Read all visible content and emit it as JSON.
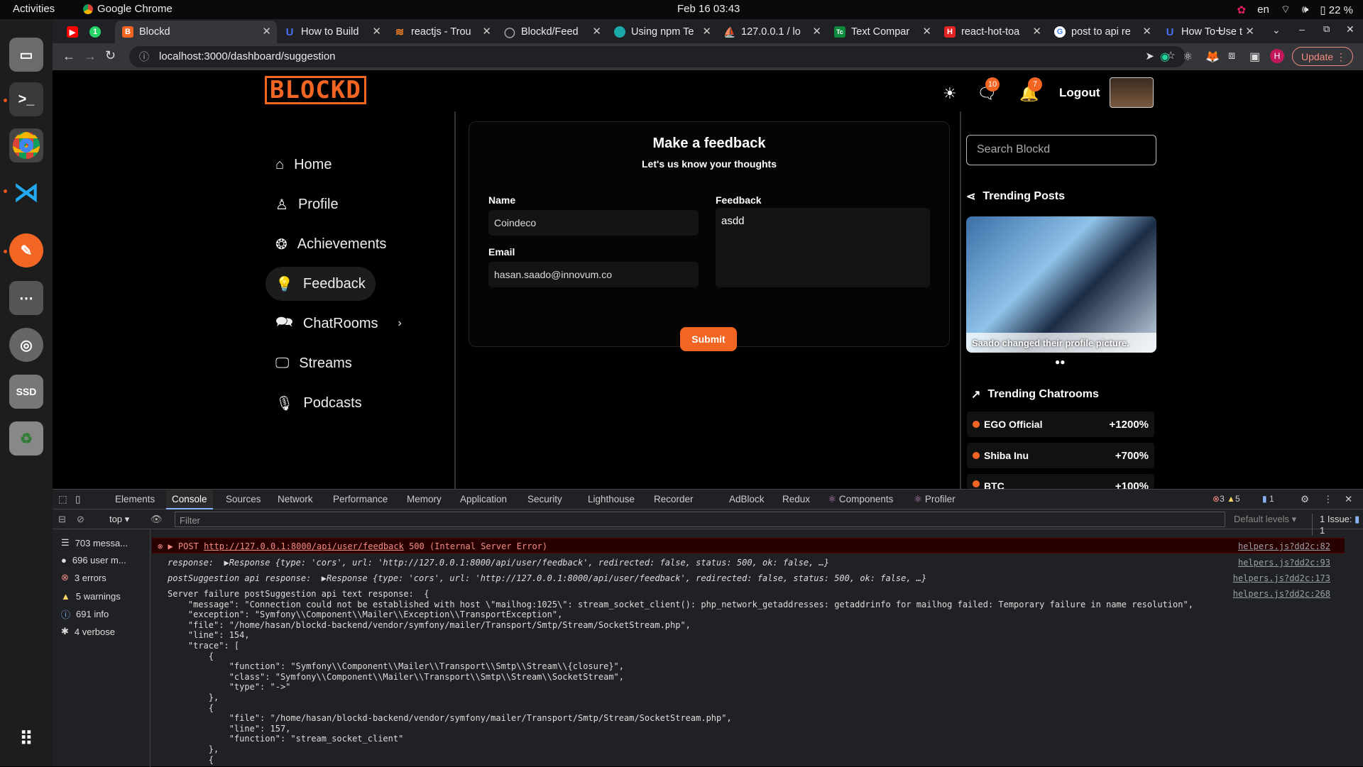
{
  "topbar": {
    "activities": "Activities",
    "app": "Google Chrome",
    "clock": "Feb 16  03:43",
    "lang": "en",
    "battery": "22 %"
  },
  "tabs": [
    {
      "label": "",
      "icon": "youtube-icon",
      "color": "#ff0000"
    },
    {
      "label": "",
      "icon": "whatsapp-icon",
      "color": "#25d366"
    },
    {
      "label": "Blockd",
      "icon": "blockd-icon",
      "color": "#f26522"
    },
    {
      "label": "How to Build",
      "icon": "u-icon",
      "color": "#4a6cf7"
    },
    {
      "label": "reactjs - Trou",
      "icon": "stackoverflow-icon",
      "color": "#f48024"
    },
    {
      "label": "Blockd/Feed",
      "icon": "github-icon",
      "color": "#888"
    },
    {
      "label": "Using npm Te",
      "icon": "globe-icon",
      "color": "#1ba9a9"
    },
    {
      "label": "127.0.0.1 / lo",
      "icon": "phpmyadmin-icon",
      "color": "#e8a33d"
    },
    {
      "label": "Text Compar",
      "icon": "tc-icon",
      "color": "#0a8a3a"
    },
    {
      "label": "react-hot-toa",
      "icon": "rh-icon",
      "color": "#e02424"
    },
    {
      "label": "post to api re",
      "icon": "google-icon",
      "color": "#4285f4"
    },
    {
      "label": "How To Use t",
      "icon": "u-icon",
      "color": "#4a6cf7"
    }
  ],
  "url": "localhost:3000/dashboard/suggestion",
  "update_label": "Update",
  "header": {
    "logo": "BLOCKD",
    "msg_badge": "10",
    "notif_badge": "7",
    "logout": "Logout"
  },
  "nav": [
    "Home",
    "Profile",
    "Achievements",
    "Feedback",
    "ChatRooms",
    "Streams",
    "Podcasts"
  ],
  "form": {
    "title": "Make a feedback",
    "subtitle": "Let's us know your thoughts",
    "name_label": "Name",
    "name_value": "Coindeco",
    "email_label": "Email",
    "email_value": "hasan.saado@innovum.co",
    "feedback_label": "Feedback",
    "feedback_value": "asdd",
    "submit": "Submit"
  },
  "right": {
    "search_placeholder": "Search Blockd",
    "trending_posts": "Trending Posts",
    "post_caption": "Saado changed their profile picture.",
    "trending_rooms": "Trending Chatrooms",
    "rooms": [
      {
        "name": "EGO Official",
        "change": "+1200%"
      },
      {
        "name": "Shiba Inu",
        "change": "+700%"
      },
      {
        "name": "BTC",
        "change": "+100%"
      }
    ]
  },
  "devtools": {
    "tabs": [
      "Elements",
      "Console",
      "Sources",
      "Network",
      "Performance",
      "Memory",
      "Application",
      "Security",
      "Lighthouse",
      "Recorder",
      "AdBlock",
      "Redux",
      "Components",
      "Profiler"
    ],
    "counts": {
      "errors": "3",
      "warnings": "5",
      "info": "1"
    },
    "context": "top",
    "filter": "Filter",
    "levels": "Default levels",
    "issues": "1 Issue:",
    "issue_count": "1",
    "sidebar": [
      "703 messa...",
      "696 user m...",
      "3 errors",
      "5 warnings",
      "691 info",
      "4 verbose"
    ],
    "error_post": "POST",
    "error_url": "http://127.0.0.1:8000/api/user/feedback",
    "error_status": "500 (Internal Server Error)",
    "src1": "helpers.js?dd2c:82",
    "src2": "helpers.js?dd2c:93",
    "src3": "helpers.js?dd2c:173",
    "src4": "helpers.js?dd2c:268",
    "line_response": "response:  ▶Response {type: 'cors', url: 'http://127.0.0.1:8000/api/user/feedback', redirected: false, status: 500, ok: false, …}",
    "line_post": "postSuggestion api response:  ▶Response {type: 'cors', url: 'http://127.0.0.1:8000/api/user/feedback', redirected: false, status: 500, ok: false, …}",
    "server_failure": "Server failure postSuggestion api text response:  {\n    \"message\": \"Connection could not be established with host \\\"mailhog:1025\\\": stream_socket_client(): php_network_getaddresses: getaddrinfo for mailhog failed: Temporary failure in name resolution\",\n    \"exception\": \"Symfony\\\\Component\\\\Mailer\\\\Exception\\\\TransportException\",\n    \"file\": \"/home/hasan/blockd-backend/vendor/symfony/mailer/Transport/Smtp/Stream/SocketStream.php\",\n    \"line\": 154,\n    \"trace\": [\n        {\n            \"function\": \"Symfony\\\\Component\\\\Mailer\\\\Transport\\\\Smtp\\\\Stream\\\\{closure}\",\n            \"class\": \"Symfony\\\\Component\\\\Mailer\\\\Transport\\\\Smtp\\\\Stream\\\\SocketStream\",\n            \"type\": \"->\"\n        },\n        {\n            \"file\": \"/home/hasan/blockd-backend/vendor/symfony/mailer/Transport/Smtp/Stream/SocketStream.php\",\n            \"line\": 157,\n            \"function\": \"stream_socket_client\"\n        },\n        {"
  }
}
